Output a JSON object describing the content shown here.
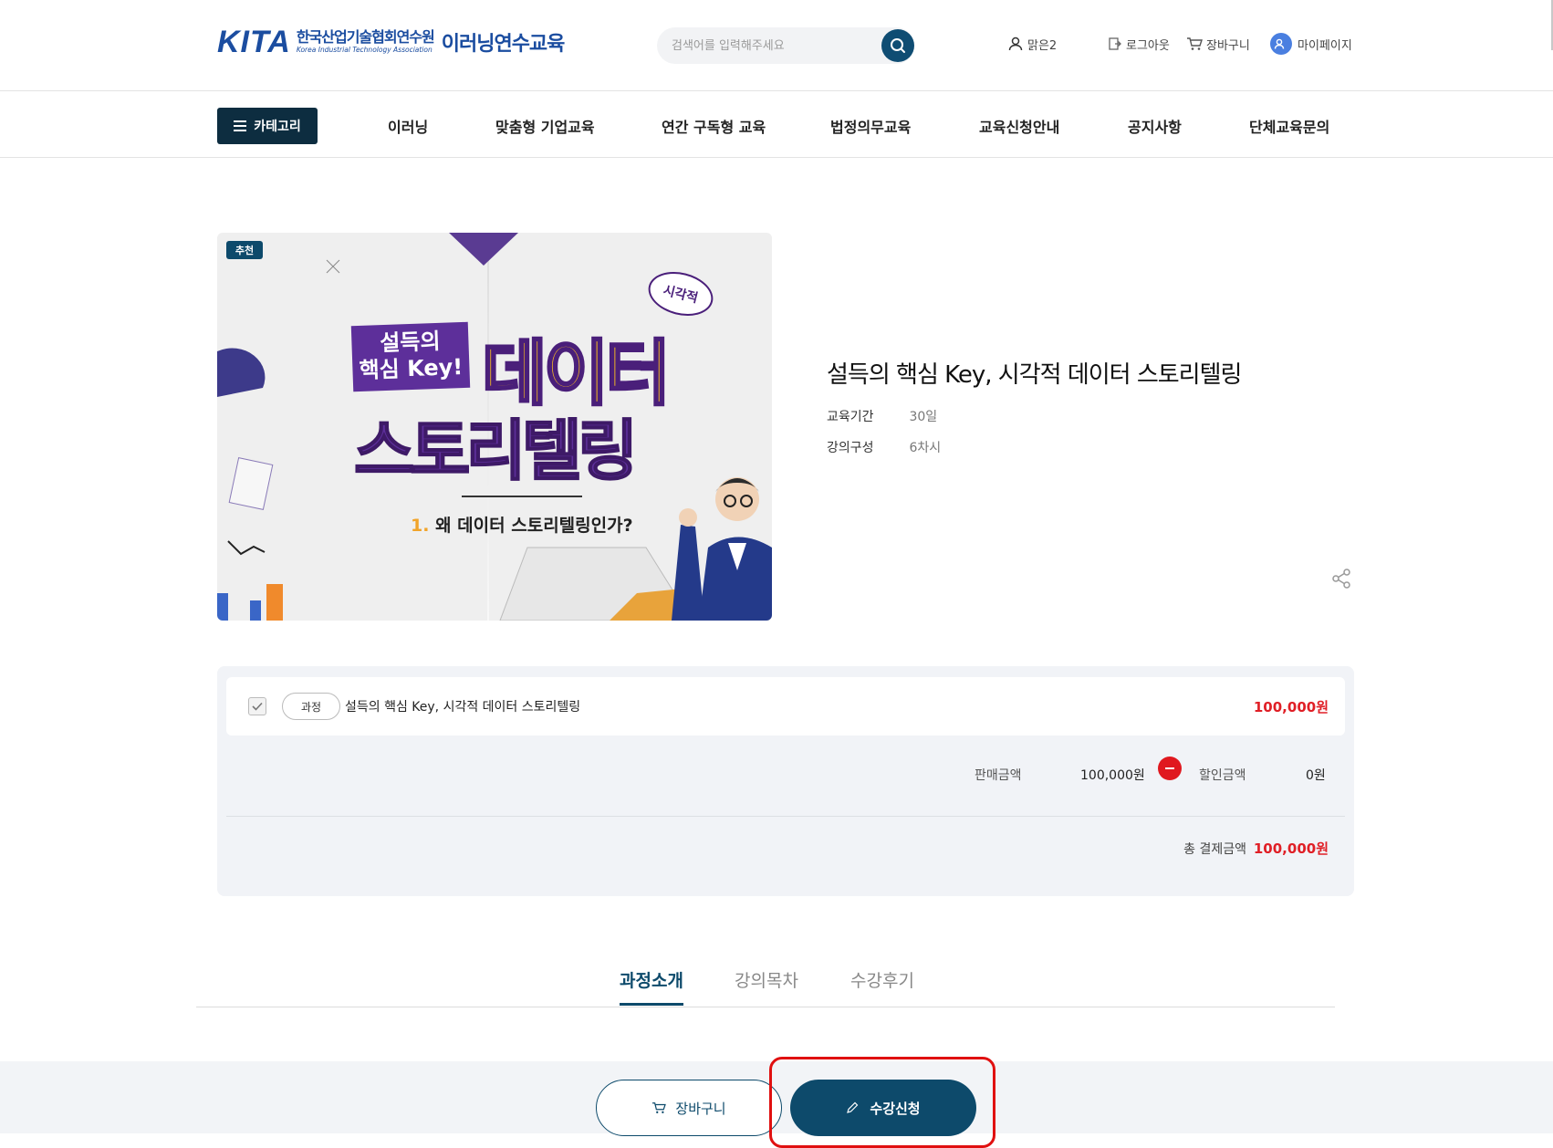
{
  "header": {
    "logo_mark": "KITA",
    "logo_org_ko": "한국산업기술협회연수원",
    "logo_org_en": "Korea Industrial Technology Association",
    "logo_service": "이러닝연수교육",
    "search_placeholder": "검색어를 입력해주세요",
    "user_name": "맑은2",
    "logout_label": "로그아웃",
    "cart_label": "장바구니",
    "mypage_label": "마이페이지"
  },
  "nav": {
    "category_label": "카테고리",
    "items": [
      "이러닝",
      "맞춤형 기업교육",
      "연간 구독형 교육",
      "법정의무교육",
      "교육신청안내",
      "공지사항",
      "단체교육문의"
    ]
  },
  "product": {
    "badge": "추천",
    "thumb": {
      "tag_line1": "설득의",
      "tag_line2": "핵심 Key!",
      "big_line1": "데이터",
      "big_line2": "스토리텔링",
      "sticker": "시각적",
      "sub_num": "1.",
      "sub_text": "왜 데이터 스토리텔링인가?"
    },
    "title": "설득의 핵심 Key, 시각적 데이터 스토리텔링",
    "meta": [
      {
        "label": "교육기간",
        "value": "30일"
      },
      {
        "label": "강의구성",
        "value": "6차시"
      }
    ]
  },
  "pricing": {
    "item_type": "과정",
    "item_name": "설득의 핵심 Key, 시각적 데이터 스토리텔링",
    "item_price": "100,000원",
    "sale_label": "판매금액",
    "sale_value": "100,000원",
    "discount_label": "할인금액",
    "discount_value": "0원",
    "total_label": "총 결제금액",
    "total_value": "100,000원",
    "checked": true
  },
  "tabs": [
    {
      "label": "과정소개",
      "active": true
    },
    {
      "label": "강의목차",
      "active": false
    },
    {
      "label": "수강후기",
      "active": false
    }
  ],
  "actions": {
    "cart_label": "장바구니",
    "apply_label": "수강신청"
  },
  "colors": {
    "primary": "#0d4a6b",
    "accent_red": "#e01f26",
    "nav_dark": "#0d2d40"
  }
}
